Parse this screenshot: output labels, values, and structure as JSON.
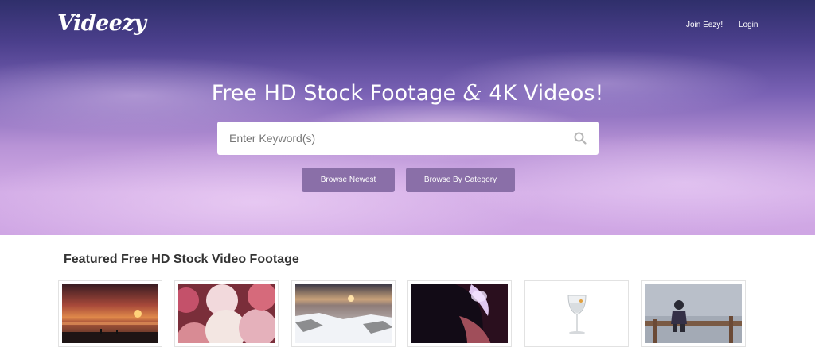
{
  "header": {
    "logo_text": "Videezy",
    "nav": {
      "join_label": "Join Eezy!",
      "login_label": "Login"
    }
  },
  "hero": {
    "title_part1": "Free HD Stock Footage ",
    "title_amp": "&",
    "title_part2": " 4K Videos!",
    "search": {
      "placeholder": "Enter Keyword(s)",
      "value": "",
      "icon": "search-icon"
    },
    "buttons": {
      "newest_label": "Browse Newest",
      "category_label": "Browse By Category"
    }
  },
  "featured": {
    "title": "Featured Free HD Stock Video Footage",
    "thumbnails": [
      {
        "subject": "sunset-beach"
      },
      {
        "subject": "balloons"
      },
      {
        "subject": "snowy-aerial"
      },
      {
        "subject": "canyon-light"
      },
      {
        "subject": "wine-glass"
      },
      {
        "subject": "person-on-pier"
      }
    ]
  },
  "colors": {
    "button_bg": "#8a6fa8",
    "text_dark": "#333333",
    "hero_top": "#2f2f6b",
    "hero_bottom": "#cfa6e4"
  }
}
